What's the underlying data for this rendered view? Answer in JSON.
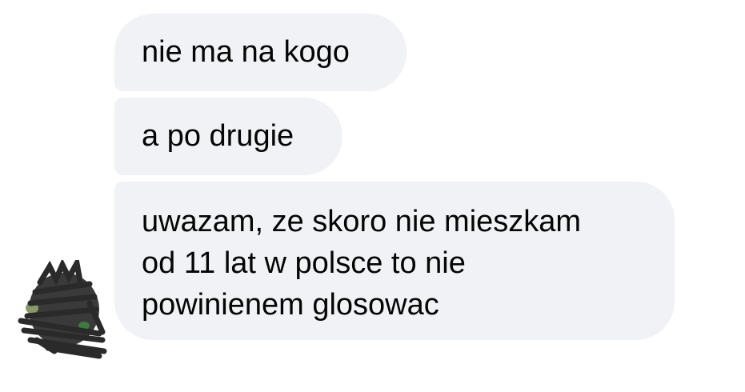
{
  "conversation": {
    "messages": [
      {
        "text": "nie ma na kogo"
      },
      {
        "text": "a po drugie"
      },
      {
        "text": "uwazam, ze skoro nie mieszkam\nod 11 lat w polsce to nie\npowinienem glosowac"
      }
    ]
  },
  "colors": {
    "bubble_background": "#f1f2f6",
    "text": "#050505",
    "scribble": "#2f2f2f"
  },
  "avatar": {
    "icon": "scribbled-avatar-icon"
  }
}
